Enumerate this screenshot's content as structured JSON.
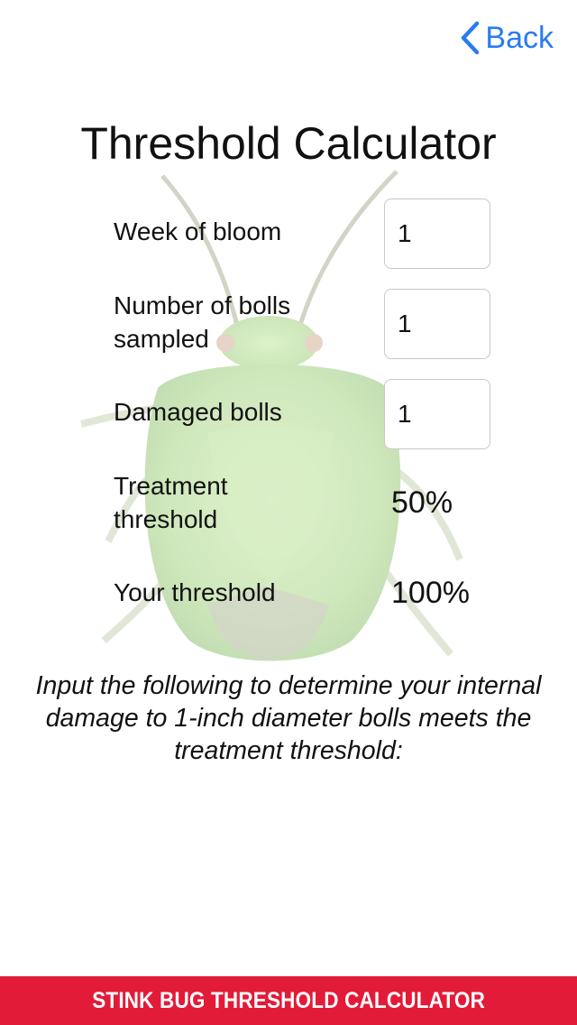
{
  "nav": {
    "back_label": "Back",
    "accent_color": "#2a7bf0"
  },
  "page": {
    "title": "Threshold Calculator",
    "background_image": "stink-bug-illustration"
  },
  "form": {
    "week_of_bloom": {
      "label": "Week of bloom",
      "value": "1"
    },
    "bolls_sampled": {
      "label": "Number of bolls sampled",
      "value": "1"
    },
    "damaged_bolls": {
      "label": "Damaged bolls",
      "value": "1"
    }
  },
  "results": {
    "treatment_threshold": {
      "label": "Treatment threshold",
      "value": "50%"
    },
    "your_threshold": {
      "label": "Your threshold",
      "value": "100%"
    }
  },
  "instructions": "Input the following to determine your internal damage to 1-inch diameter bolls meets the treatment threshold:",
  "footer": {
    "title": "STINK BUG THRESHOLD CALCULATOR",
    "color": "#e21b38"
  }
}
